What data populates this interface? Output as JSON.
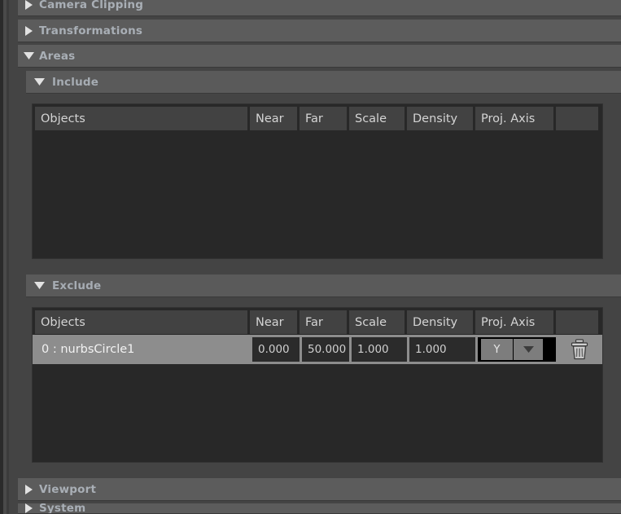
{
  "theme": {
    "panel_bg": "#444444",
    "section_header_bg": "#5c5c5c",
    "section_label_color": "#a9afb6",
    "table_bg": "#282828",
    "header_cell_bg": "#424242",
    "selected_row_bg": "#8d8d8d",
    "field_bg": "#2b2b2b",
    "combo_bg": "#000000"
  },
  "sections": [
    {
      "id": "camera-clipping",
      "label": "Camera Clipping",
      "level": 1,
      "expanded": false,
      "icon": "triangle-right-icon"
    },
    {
      "id": "transformations",
      "label": "Transformations",
      "level": 1,
      "expanded": false,
      "icon": "triangle-right-icon"
    },
    {
      "id": "areas",
      "label": "Areas",
      "level": 1,
      "expanded": true,
      "icon": "triangle-down-icon"
    },
    {
      "id": "include",
      "label": "Include",
      "level": 2,
      "expanded": true,
      "icon": "triangle-down-icon"
    },
    {
      "id": "exclude",
      "label": "Exclude",
      "level": 2,
      "expanded": true,
      "icon": "triangle-down-icon"
    },
    {
      "id": "viewport",
      "label": "Viewport",
      "level": 1,
      "expanded": false,
      "icon": "triangle-right-icon"
    },
    {
      "id": "system",
      "label": "System",
      "level": 1,
      "expanded": false,
      "icon": "triangle-right-icon"
    }
  ],
  "columns": {
    "objects": "Objects",
    "near": "Near",
    "far": "Far",
    "scale": "Scale",
    "density": "Density",
    "proj_axis": "Proj. Axis",
    "actions": ""
  },
  "include_table": {
    "rows": []
  },
  "exclude_table": {
    "rows": [
      {
        "name": "0 : nurbsCircle1",
        "near": "0.000",
        "far": "50.000",
        "scale": "1.000",
        "density": "1.000",
        "proj_axis": "Y",
        "selected": true,
        "delete_icon": "trash-icon"
      }
    ]
  }
}
